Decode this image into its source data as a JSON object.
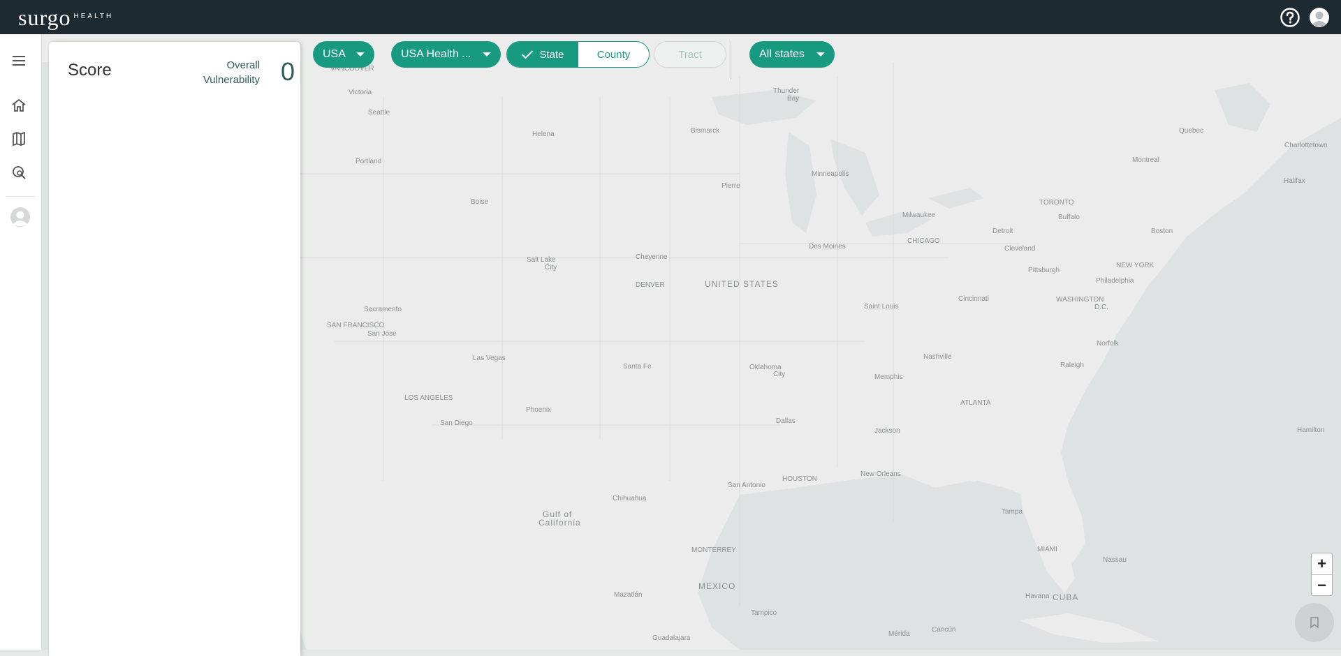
{
  "header": {
    "logo_main": "surgo",
    "logo_sub": "HEALTH",
    "help_icon": "help-circle-icon",
    "profile_icon": "account-icon"
  },
  "sidebar": {
    "items": [
      {
        "icon": "menu-icon"
      },
      {
        "icon": "home-icon"
      },
      {
        "icon": "map-icon"
      },
      {
        "icon": "explore-icon"
      },
      {
        "icon": "user-avatar-icon"
      }
    ]
  },
  "score_panel": {
    "title": "Score",
    "metric_label": "Overall Vulnerability",
    "metric_value": "0"
  },
  "toolbar": {
    "country": "USA",
    "dataset": "USA Health ...",
    "geo_levels": [
      "State",
      "County",
      "Tract"
    ],
    "selected_level": "State",
    "region": "All states"
  },
  "map": {
    "labels": [
      "Vancouver",
      "Victoria",
      "Seattle",
      "Portland",
      "Helena",
      "Boise",
      "Bismarck",
      "Pierre",
      "Thunder Bay",
      "Minneapolis",
      "Quebec",
      "Charlottetown",
      "Montreal",
      "Halifax",
      "Toronto",
      "Buffalo",
      "Detroit",
      "Milwaukee",
      "Chicago",
      "Cleveland",
      "Boston",
      "Pittsburgh",
      "New York",
      "Philadelphia",
      "Washington D.C.",
      "Des Moines",
      "Cheyenne",
      "Denver",
      "United States",
      "Salt Lake City",
      "Sacramento",
      "San Francisco",
      "San Jose",
      "Las Vegas",
      "Saint Louis",
      "Cincinnati",
      "Nashville",
      "Norfolk",
      "Raleigh",
      "Santa Fe",
      "Oklahoma City",
      "Memphis",
      "Atlanta",
      "Los Angeles",
      "Phoenix",
      "San Diego",
      "Dallas",
      "Jackson",
      "Hamilton",
      "Houston",
      "San Antonio",
      "New Orleans",
      "Chihuahua",
      "Gulf of California",
      "Tampa",
      "Monterrey",
      "Miami",
      "Nassau",
      "Mexico",
      "Havana",
      "Cuba",
      "Mazatlán",
      "Tampico",
      "Guadalajara",
      "Mérida",
      "Cancún"
    ],
    "zoom_in": "+",
    "zoom_out": "−",
    "bookmark_icon": "bookmark-icon"
  }
}
